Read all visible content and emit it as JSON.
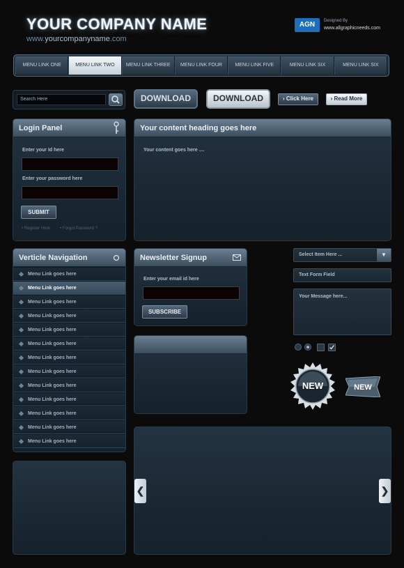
{
  "header": {
    "company_name": "YOUR COMPANY NAME",
    "url_www": "www.",
    "url_domain": "yourcompanyname",
    "url_tld": ".com",
    "logo_text": "AGN",
    "designed_by": "Designed By",
    "designer_url": "www.allgraphicneeds.com"
  },
  "menu": {
    "items": [
      {
        "label": "MENU LINK ONE"
      },
      {
        "label": "MENU LINK TWO"
      },
      {
        "label": "MENU LINK THREE"
      },
      {
        "label": "MENU LINK FOUR"
      },
      {
        "label": "MENU LINK FIVE"
      },
      {
        "label": "MENU LINK SIX"
      },
      {
        "label": "MENU LINK SIX"
      }
    ],
    "active_index": 1
  },
  "search": {
    "placeholder": "Search Here"
  },
  "buttons": {
    "download_dark": "DOWNLOAD",
    "download_light": "DOWNLOAD",
    "click_here": "Click Here",
    "read_more": "Read More"
  },
  "login": {
    "title": "Login Panel",
    "id_label": "Enter your Id here",
    "password_label": "Enter your password here",
    "submit": "SUBMIT",
    "register": "Register Here",
    "forgot": "Forgot Password ?"
  },
  "content": {
    "heading": "Your content heading goes here",
    "body": "Your content goes here ...."
  },
  "vertical_nav": {
    "title": "Verticle Navigation",
    "items": [
      {
        "label": "Menu Link goes here"
      },
      {
        "label": "Menu Link goes here"
      },
      {
        "label": "Menu Link goes here"
      },
      {
        "label": "Menu Link goes here"
      },
      {
        "label": "Menu Link goes here"
      },
      {
        "label": "Menu Link goes here"
      },
      {
        "label": "Menu Link goes here"
      },
      {
        "label": "Menu Link goes here"
      },
      {
        "label": "Menu Link goes here"
      },
      {
        "label": "Menu Link goes here"
      },
      {
        "label": "Menu Link goes here"
      },
      {
        "label": "Menu Link goes here"
      },
      {
        "label": "Menu Link goes here"
      }
    ],
    "active_index": 1
  },
  "newsletter": {
    "title": "Newsletter Signup",
    "email_label": "Enter your email id here",
    "subscribe": "SUBSCRIBE"
  },
  "form": {
    "select_value": "Select Item Here ...",
    "text_field": "Text Form Field",
    "message": "Your Message here..."
  },
  "badges": {
    "new_round": "NEW",
    "new_ribbon": "NEW"
  },
  "slider": {
    "prev": "❮",
    "next": "❯"
  }
}
